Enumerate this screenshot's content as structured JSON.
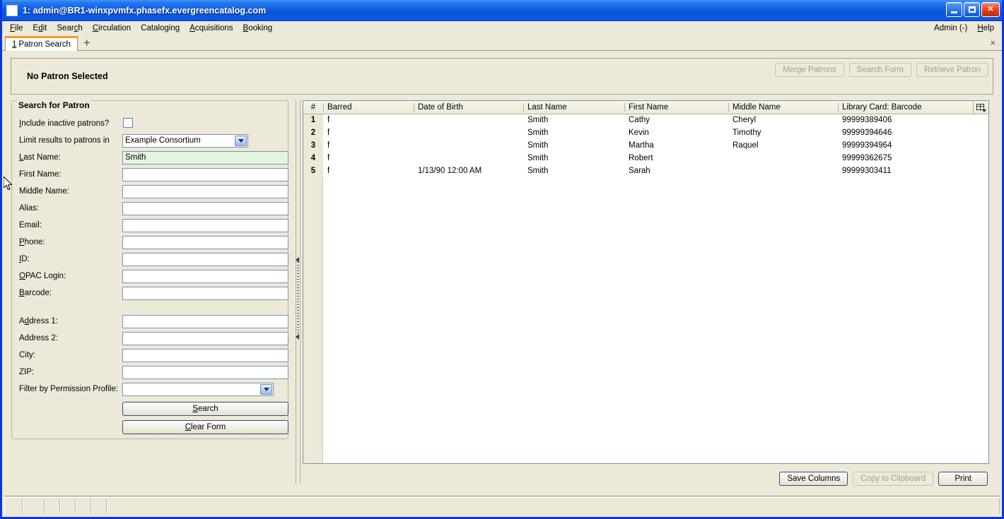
{
  "window": {
    "title": "1: admin@BR1-winxpvmfx.phasefx.evergreencatalog.com",
    "icon": "window-icon",
    "minimize_label": "Minimize",
    "maximize_label": "Maximize",
    "close_label": "Close"
  },
  "menubar": {
    "items": [
      {
        "label": "File"
      },
      {
        "label": "Edit"
      },
      {
        "label": "Search"
      },
      {
        "label": "Circulation"
      },
      {
        "label": "Cataloging"
      },
      {
        "label": "Acquisitions"
      },
      {
        "label": "Booking"
      }
    ],
    "right_items": [
      {
        "label": "Admin (-)"
      },
      {
        "label": "Help"
      }
    ]
  },
  "tabs": {
    "items": [
      {
        "number": "1",
        "label": "Patron Search",
        "active": true
      }
    ],
    "new_tab_label": "+",
    "close_label": "×"
  },
  "patron_bar": {
    "title": "No Patron Selected",
    "buttons": [
      {
        "label": "Merge Patrons",
        "disabled": true
      },
      {
        "label": "Search Form",
        "disabled": true
      },
      {
        "label": "Retrieve Patron",
        "disabled": true
      }
    ]
  },
  "search_form": {
    "legend": "Search for Patron",
    "include_inactive_label": "Include inactive patrons?",
    "include_inactive_checked": false,
    "limit_results_label": "Limit results to patrons in",
    "limit_results_value": "Example Consortium",
    "fields": [
      {
        "label": "Last Name:",
        "value": "Smith",
        "placeholder": "",
        "focused": true
      },
      {
        "label": "First Name:",
        "value": "",
        "placeholder": "",
        "focused": false
      },
      {
        "label": "Middle Name:",
        "value": "",
        "placeholder": "",
        "focused": false
      },
      {
        "label": "Alias:",
        "value": "",
        "placeholder": "",
        "focused": false
      },
      {
        "label": "Email:",
        "value": "",
        "placeholder": "",
        "focused": false
      },
      {
        "label": "Phone:",
        "value": "",
        "placeholder": "",
        "focused": false
      },
      {
        "label": "ID:",
        "value": "",
        "placeholder": "",
        "focused": false
      },
      {
        "label": "OPAC Login:",
        "value": "",
        "placeholder": "",
        "focused": false
      },
      {
        "label": "Barcode:",
        "value": "",
        "placeholder": "",
        "focused": false
      }
    ],
    "address_fields": [
      {
        "label": "Address 1:",
        "value": "",
        "placeholder": "",
        "focused": false
      },
      {
        "label": "Address 2:",
        "value": "",
        "placeholder": "",
        "focused": false
      },
      {
        "label": "City:",
        "value": "",
        "placeholder": "",
        "focused": false
      },
      {
        "label": "ZIP:",
        "value": "",
        "placeholder": "",
        "focused": false
      }
    ],
    "permission_profile_label": "Filter by Permission Profile:",
    "permission_profile_value": "",
    "search_button": "Search",
    "clear_button": "Clear Form"
  },
  "results": {
    "columns": [
      "#",
      "Barred",
      "Date of Birth",
      "Last Name",
      "First Name",
      "Middle Name",
      "Library Card: Barcode"
    ],
    "rows": [
      {
        "num": "1",
        "barred": "f",
        "dob": "",
        "last": "Smith",
        "first": "Cathy",
        "middle": "Cheryl",
        "barcode": "99999389406"
      },
      {
        "num": "2",
        "barred": "f",
        "dob": "",
        "last": "Smith",
        "first": "Kevin",
        "middle": "Timothy",
        "barcode": "99999394646"
      },
      {
        "num": "3",
        "barred": "f",
        "dob": "",
        "last": "Smith",
        "first": "Martha",
        "middle": "Raquel",
        "barcode": "99999394964"
      },
      {
        "num": "4",
        "barred": "f",
        "dob": "",
        "last": "Smith",
        "first": "Robert",
        "middle": "",
        "barcode": "99999362675"
      },
      {
        "num": "5",
        "barred": "f",
        "dob": "1/13/90 12:00 AM",
        "last": "Smith",
        "first": "Sarah",
        "middle": "",
        "barcode": "99999303411"
      }
    ],
    "column_picker_icon": "column-picker-icon",
    "footer_buttons": [
      {
        "label": "Save Columns",
        "disabled": false
      },
      {
        "label": "Copy to Clipboard",
        "disabled": true
      },
      {
        "label": "Print",
        "disabled": false
      }
    ]
  },
  "statusbar": {
    "cells": [
      "",
      "",
      "",
      "",
      "",
      "",
      ""
    ]
  },
  "colors": {
    "titlebar_blue": "#0b55dd",
    "window_border": "#0a38d6",
    "chrome": "#ece9d8",
    "field_border": "#7c93ad",
    "focused_field": "#e1f5e0",
    "tab_accent": "#f59c1a"
  }
}
